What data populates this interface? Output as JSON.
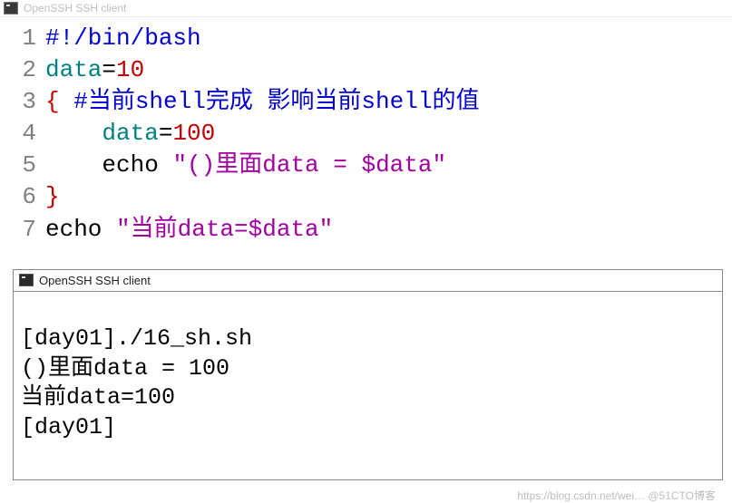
{
  "top_title": "OpenSSH SSH client",
  "code": {
    "l1": {
      "no": "1",
      "shebang": "#!/bin/bash"
    },
    "l2": {
      "no": "2",
      "var": "data",
      "eq": "=",
      "num": "10"
    },
    "l3": {
      "no": "3",
      "brace": "{",
      "sp": " ",
      "comment": "#当前shell完成 影响当前shell的值"
    },
    "l4": {
      "no": "4",
      "indent": "    ",
      "var": "data",
      "eq": "=",
      "num": "100"
    },
    "l5": {
      "no": "5",
      "indent": "    ",
      "cmd": "echo ",
      "str": "\"()里面data = $data\""
    },
    "l6": {
      "no": "6",
      "brace": "}"
    },
    "l7": {
      "no": "7",
      "cmd": "echo ",
      "str": "\"当前data=$data\""
    }
  },
  "terminal": {
    "title": "OpenSSH SSH client",
    "lines": {
      "l1": "[day01]./16_sh.sh",
      "l2": "()里面data = 100",
      "l3": "当前data=100",
      "l4": "[day01]"
    }
  },
  "watermark": "https://blog.csdn.net/wei…  @51CTO博客"
}
